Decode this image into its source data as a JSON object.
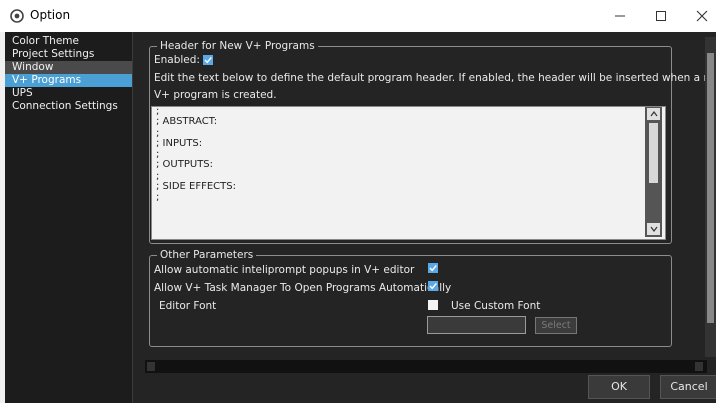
{
  "window": {
    "title": "Option",
    "minimize_symbol": "–",
    "maximize_symbol": "☐",
    "close_symbol": "✕"
  },
  "sidebar": {
    "items": [
      {
        "label": "Color Theme"
      },
      {
        "label": "Project Settings"
      },
      {
        "label": "Window"
      },
      {
        "label": "V+ Programs"
      },
      {
        "label": "UPS"
      },
      {
        "label": "Connection Settings"
      }
    ],
    "selected": "V+ Programs"
  },
  "header_group": {
    "legend": "Header for New V+ Programs",
    "enabled_label": "Enabled:",
    "enabled": true,
    "description_line1": "Edit the text below to define the default program header. If enabled, the header will be inserted when a new",
    "description_line2": "V+ program is created.",
    "editor_lines": [
      ";",
      "; ABSTRACT:",
      ";",
      "; INPUTS:",
      ";",
      "; OUTPUTS:",
      ";",
      "; SIDE EFFECTS:",
      ";"
    ]
  },
  "other_group": {
    "legend": "Other Parameters",
    "intelliprompt_label": "Allow automatic inteliprompt popups in V+ editor",
    "intelliprompt_checked": true,
    "task_manager_label": "Allow V+ Task Manager To Open Programs Automatically",
    "task_manager_checked": true,
    "editor_font_label": "Editor Font",
    "custom_font_label": "Use Custom Font",
    "custom_font_checked": false,
    "font_value": "",
    "select_label": "Select"
  },
  "footer": {
    "ok_label": "OK",
    "cancel_label": "Cancel"
  },
  "colors": {
    "accent": "#4a9fd4",
    "panel_bg": "#242424",
    "check_blue": "#5aa8e8"
  },
  "icons": {
    "app": "option-gear-icon",
    "checkbox_checked": "checkmark-icon",
    "scroll_up": "chevron-up-icon",
    "scroll_down": "chevron-down-icon"
  }
}
